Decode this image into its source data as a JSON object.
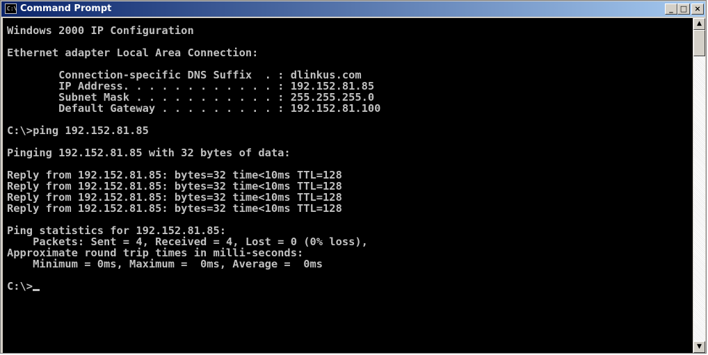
{
  "window": {
    "title": "Command Prompt",
    "icon": "cmd-icon",
    "icon_glyph": "C:\\",
    "buttons": {
      "minimize": "_",
      "maximize": "□",
      "close": "×"
    }
  },
  "console": {
    "lines": [
      "Windows 2000 IP Configuration",
      "",
      "Ethernet adapter Local Area Connection:",
      "",
      "        Connection-specific DNS Suffix  . : dlinkus.com",
      "        IP Address. . . . . . . . . . . . : 192.152.81.85",
      "        Subnet Mask . . . . . . . . . . . : 255.255.255.0",
      "        Default Gateway . . . . . . . . . : 192.152.81.100",
      "",
      "C:\\>ping 192.152.81.85",
      "",
      "Pinging 192.152.81.85 with 32 bytes of data:",
      "",
      "Reply from 192.152.81.85: bytes=32 time<10ms TTL=128",
      "Reply from 192.152.81.85: bytes=32 time<10ms TTL=128",
      "Reply from 192.152.81.85: bytes=32 time<10ms TTL=128",
      "Reply from 192.152.81.85: bytes=32 time<10ms TTL=128",
      "",
      "Ping statistics for 192.152.81.85:",
      "    Packets: Sent = 4, Received = 4, Lost = 0 (0% loss),",
      "Approximate round trip times in milli-seconds:",
      "    Minimum = 0ms, Maximum =  0ms, Average =  0ms",
      ""
    ],
    "prompt": "C:\\>"
  },
  "scrollbar": {
    "up_arrow": "▲",
    "down_arrow": "▼"
  },
  "colors": {
    "titlebar_start": "#0a246a",
    "titlebar_end": "#a6caf0",
    "console_bg": "#000000",
    "console_fg": "#c0c0c0"
  }
}
